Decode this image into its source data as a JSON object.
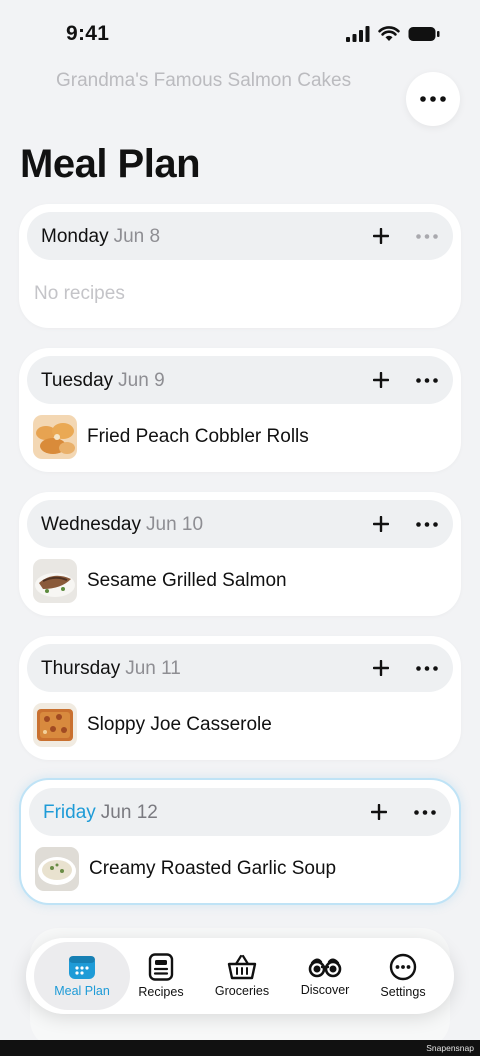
{
  "status_bar": {
    "time": "9:41"
  },
  "header": {
    "title": "Meal Plan"
  },
  "days": [
    {
      "weekday": "Monday",
      "date": "Jun 8",
      "empty_text": "No recipes",
      "recipe": null
    },
    {
      "weekday": "Tuesday",
      "date": "Jun 9",
      "recipe": "Fried Peach Cobbler Rolls"
    },
    {
      "weekday": "Wednesday",
      "date": "Jun 10",
      "recipe": "Sesame Grilled Salmon"
    },
    {
      "weekday": "Thursday",
      "date": "Jun 11",
      "recipe": "Sloppy Joe Casserole"
    },
    {
      "weekday": "Friday",
      "date": "Jun 12",
      "recipe": "Creamy Roasted Garlic Soup"
    }
  ],
  "peek_recipe": "Grandma's Famous Salmon Cakes",
  "tabs": [
    {
      "label": "Meal Plan",
      "icon": "calendar-icon",
      "active": true
    },
    {
      "label": "Recipes",
      "icon": "recipe-card-icon",
      "active": false
    },
    {
      "label": "Groceries",
      "icon": "basket-icon",
      "active": false
    },
    {
      "label": "Discover",
      "icon": "binoculars-icon",
      "active": false
    },
    {
      "label": "Settings",
      "icon": "ellipsis-circle-icon",
      "active": false
    }
  ],
  "watermark": "Snapensnap",
  "colors": {
    "accent": "#1e9bd7",
    "background": "#f2f3f5",
    "card": "#ffffff",
    "header_pill": "#eef0f2",
    "muted": "#8e8e93"
  }
}
